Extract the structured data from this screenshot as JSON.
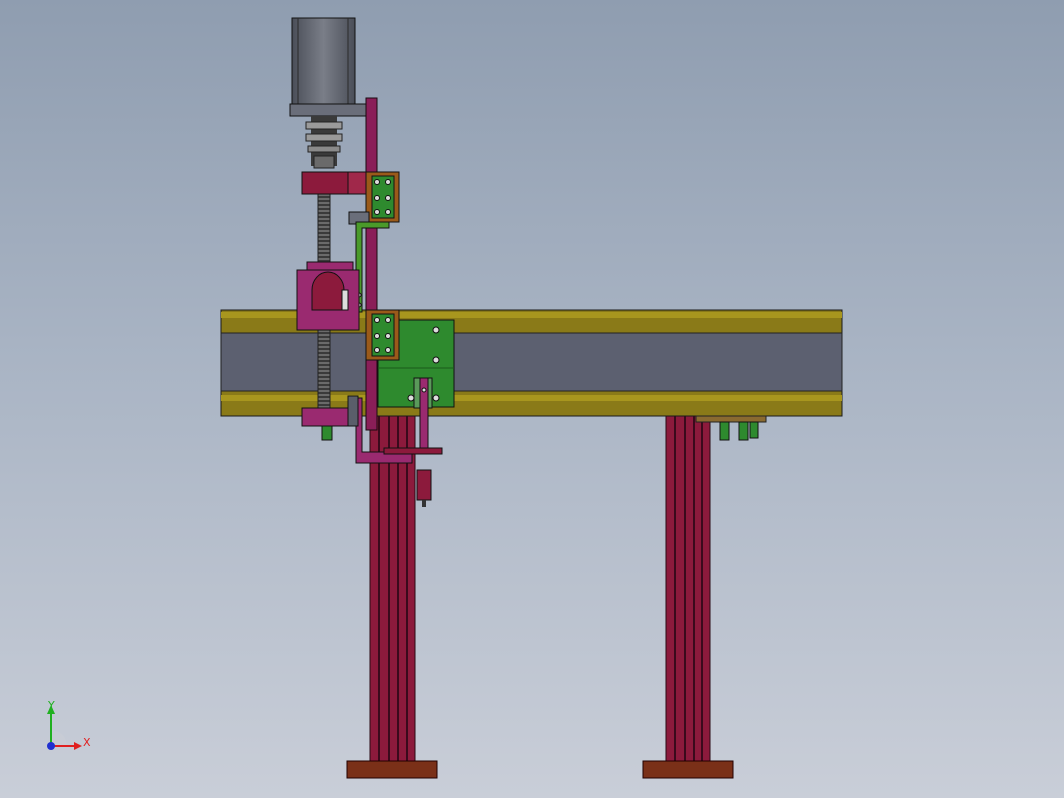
{
  "triad": {
    "x_label": "X",
    "y_label": "Y",
    "x_color": "#e02020",
    "y_color": "#20b020",
    "z_color": "#2030d0"
  },
  "colors": {
    "background_top": "#8f9db0",
    "background_bottom": "#c9ced8",
    "beam_rail": "#8a7a18",
    "beam_core": "#5c6070",
    "column": "#8c1a3c",
    "foot": "#7a3018",
    "motor": "#5a5e68",
    "vertical_plate": "#8a1e58",
    "carriage": "#9a2a70",
    "ballscrew": "#555555",
    "green_plate": "#2e8a2e",
    "bearing_block": "#9a5a1a"
  }
}
